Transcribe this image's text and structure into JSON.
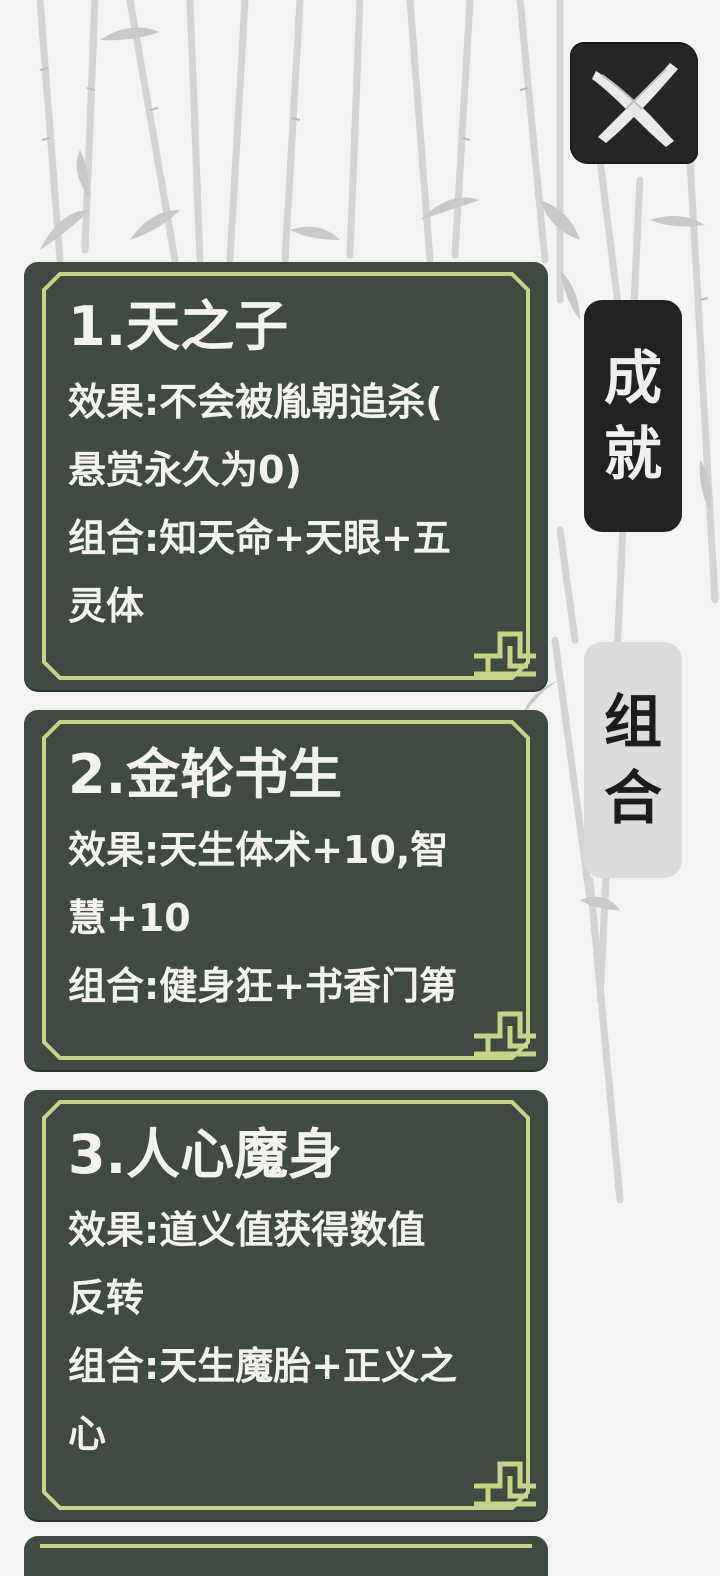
{
  "header": {
    "close_icon": "brush-x-close-icon"
  },
  "tabs": [
    {
      "id": "achievements",
      "chars": [
        "成",
        "就"
      ],
      "active": true
    },
    {
      "id": "combos",
      "chars": [
        "组",
        "合"
      ],
      "active": false
    }
  ],
  "cards": [
    {
      "title": "1.天之子",
      "lines": [
        "效果:不会被胤朝追杀(",
        "悬赏永久为0)",
        "组合:知天命+天眼+五",
        "灵体"
      ]
    },
    {
      "title": "2.金轮书生",
      "lines": [
        "效果:天生体术+10,智",
        "慧+10",
        "组合:健身狂+书香门第"
      ]
    },
    {
      "title": "3.人心魔身",
      "lines": [
        "效果:道义值获得数值",
        "反转",
        "组合:天生魔胎+正义之",
        "心"
      ]
    }
  ],
  "colors": {
    "card_bg": "#3f4a40",
    "card_border": "#c7d38a",
    "active_tab_bg": "#222222",
    "inactive_tab_bg": "#dcdcdc"
  }
}
